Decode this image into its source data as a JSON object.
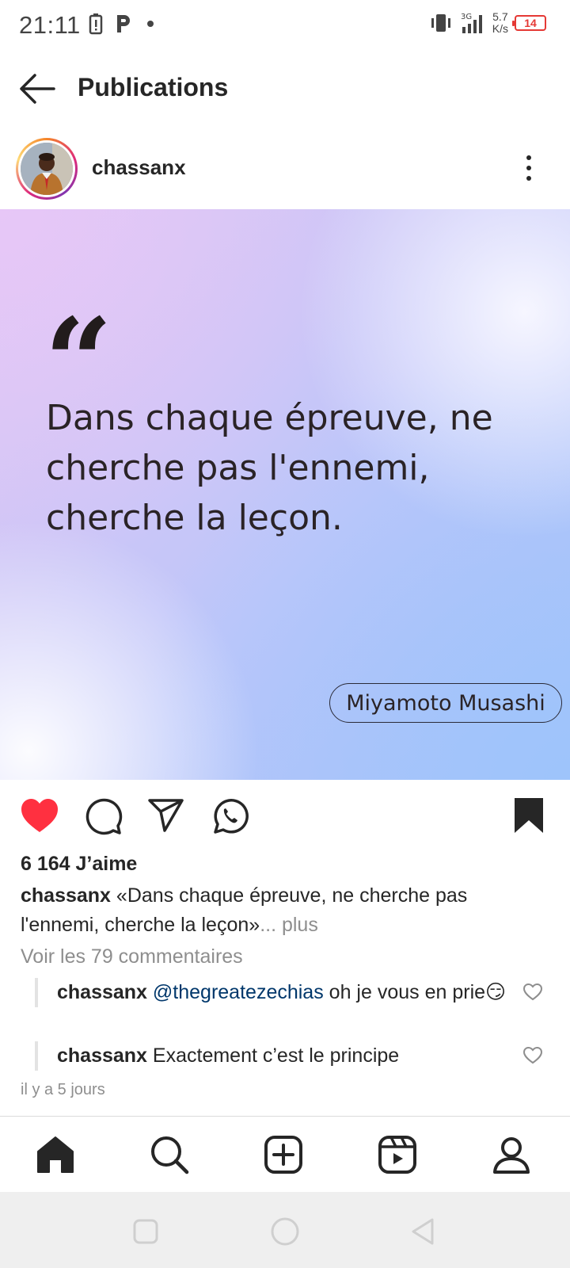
{
  "status_bar": {
    "time": "21:11",
    "network_type": "3G",
    "speed_value": "5.7",
    "speed_unit": "K/s",
    "battery": "14"
  },
  "header": {
    "title": "Publications"
  },
  "post": {
    "username": "chassanx",
    "image": {
      "quote_mark": "“",
      "quote_text": "Dans chaque épreuve, ne cherche pas l'ennemi, cherche la leçon.",
      "author": "Miyamoto Musashi"
    },
    "liked": true,
    "saved": true,
    "likes_text": "6 164 J’aime",
    "caption_user": "chassanx",
    "caption_text": "«Dans chaque épreuve, ne cherche pas l'ennemi, cherche la leçon»",
    "caption_more": "... plus",
    "view_comments": "Voir les 79 commentaires",
    "comments": [
      {
        "user": "chassanx",
        "mention": "@thegreatezechias",
        "text": "oh je vous en prie",
        "emoji": "😏"
      },
      {
        "user": "chassanx",
        "mention": "",
        "text": "Exactement c’est le principe",
        "emoji": ""
      }
    ],
    "time_ago": "il y a 5 jours"
  },
  "colors": {
    "like_red": "#ff3040",
    "text_primary": "#262626",
    "text_secondary": "#8e8e8e",
    "mention": "#00376b"
  },
  "icons": {
    "actions": [
      "heart-filled-icon",
      "comment-icon",
      "share-icon",
      "whatsapp-icon",
      "bookmark-filled-icon"
    ],
    "bottom_nav": [
      "home-icon",
      "search-icon",
      "create-icon",
      "reels-icon",
      "profile-icon"
    ],
    "system_nav": [
      "recents-icon",
      "home-circle-icon",
      "back-triangle-icon"
    ]
  }
}
